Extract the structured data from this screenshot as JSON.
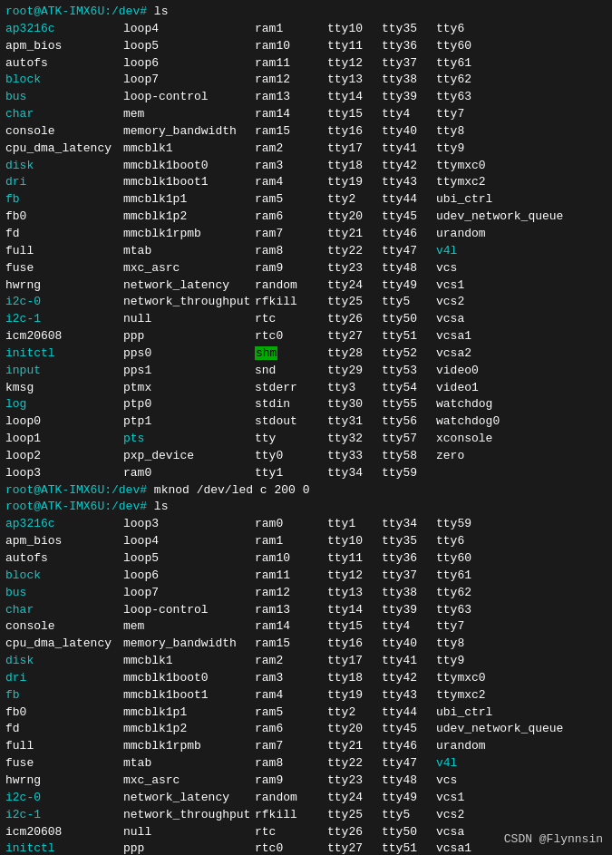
{
  "terminal": {
    "title": "root@ATK-IMX6U:/dev#",
    "watermark": "CSDN @Flynnsin",
    "prompt1": "root@ATK-IMX6U:/dev# ls",
    "prompt2": "root@ATK-IMX6U:/dev# mknod /dev/led c 200 0",
    "prompt3": "root@ATK-IMX6U:/dev# ls",
    "prompt4": "root@ATK-IMX6U:/dev# ",
    "shm_label": "shm",
    "snd_label": "snd"
  }
}
